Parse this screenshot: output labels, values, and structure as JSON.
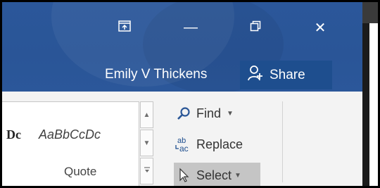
{
  "window": {
    "ribbon_display_options_icon": "ribbon-display-options-icon",
    "minimize_symbol": "—",
    "restore_icon": "restore-icon",
    "close_symbol": "✕"
  },
  "account": {
    "user_name": "Emily V Thickens",
    "share_label": "Share",
    "share_icon": "person-add-icon"
  },
  "styles_gallery": {
    "cut_style_sample": "Dc",
    "quote_style_sample": "AaBbCcDc",
    "quote_style_name": "Quote",
    "scroll_up_icon": "chevron-up-icon",
    "scroll_down_icon": "chevron-down-icon",
    "more_icon": "gallery-more-icon"
  },
  "editing": {
    "find_label": "Find",
    "find_icon": "magnifier-icon",
    "replace_label": "Replace",
    "replace_icon": "replace-icon",
    "select_label": "Select",
    "select_icon": "cursor-arrow-icon"
  },
  "colors": {
    "title_bar": "#2b579a",
    "share_button": "#1e4e8e",
    "ribbon_bg": "#f3f3f3",
    "select_highlight": "#c5c5c5"
  }
}
